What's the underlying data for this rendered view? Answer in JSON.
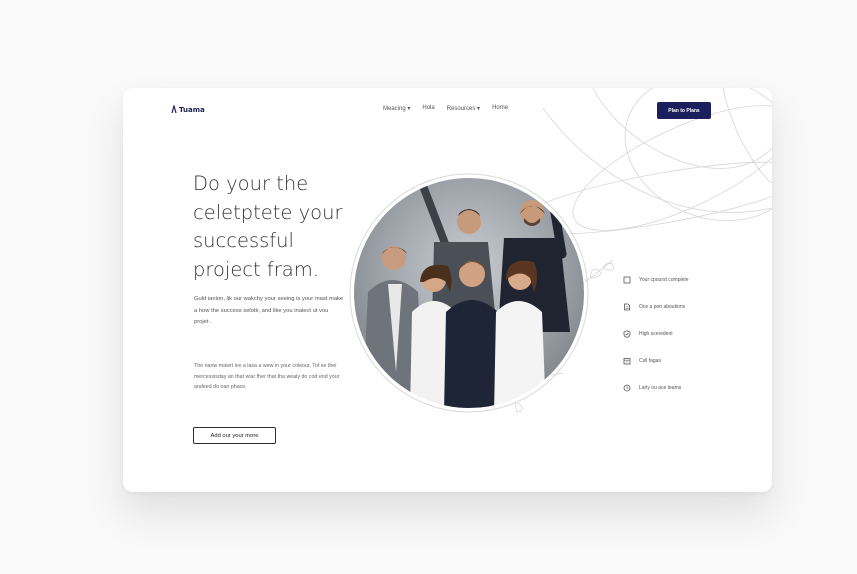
{
  "brand": {
    "name": "Tuama"
  },
  "nav": {
    "items": [
      "Meacing ▾",
      "Hola",
      "Resources ▾",
      "Home"
    ],
    "cta_label": "Plan to Plans"
  },
  "hero": {
    "headline": [
      "Do your the",
      "celetptete your",
      "successful",
      "project fram."
    ],
    "paragraph1": "Guld ianion, lik our wakchy your seeing is your mast make a how the success selotk, and like you inalect ut vou projet .",
    "paragraph2": "The nanw mawrt ive a lasa a wew in your coleour, Tot se thei mercessisday an that wiar fher that tha wealy do cod end your andeed do oan phace.",
    "cta_label": "Add our your more"
  },
  "features": [
    {
      "icon": "square-icon",
      "label": "Your cpourst complete"
    },
    {
      "icon": "document-icon",
      "label": "Oce a pon aboutions"
    },
    {
      "icon": "shield-check-icon",
      "label": "High sceredent"
    },
    {
      "icon": "calendar-icon",
      "label": "Csll fagas"
    },
    {
      "icon": "clock-icon",
      "label": "Larly ou ace teams"
    }
  ],
  "colors": {
    "brand_navy": "#1b1f5c",
    "page_background": "#f9f9f9",
    "card_background": "#ffffff"
  }
}
